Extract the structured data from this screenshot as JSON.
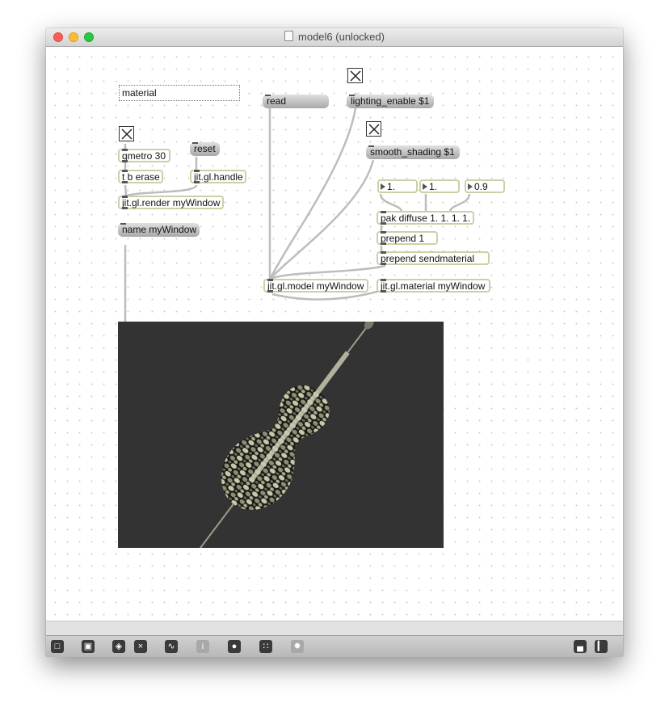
{
  "window": {
    "title": "model6 (unlocked)"
  },
  "patch": {
    "comment_material": "material",
    "msg_read": "read",
    "msg_lighting": "lighting_enable $1",
    "msg_smooth": "smooth_shading $1",
    "msg_reset": "reset",
    "msg_name": "name myWindow",
    "obj_qmetro": "qmetro 30",
    "obj_tberase": "t b erase",
    "obj_handle": "jit.gl.handle",
    "obj_render": "jit.gl.render myWindow",
    "obj_pak": "pak diffuse 1. 1. 1. 1.",
    "obj_prepend1": "prepend 1",
    "obj_prependsend": "prepend sendmaterial",
    "obj_model": "jit.gl.model myWindow",
    "obj_material": "jit.gl.material myWindow",
    "num1": "1.",
    "num2": "1.",
    "num3": "0.9"
  },
  "toolbar": {
    "icons": [
      "lock-icon",
      "presentation-icon",
      "new-object-icon",
      "delete-icon",
      "inspector-icon",
      "info-icon",
      "patch-cord-icon",
      "grid-icon",
      "snap-icon",
      "console-icon",
      "sidebar-icon"
    ]
  },
  "colors": {
    "object_border": "#c7d2a8",
    "render_background": "#333333",
    "cable": "#bdbdbd"
  }
}
